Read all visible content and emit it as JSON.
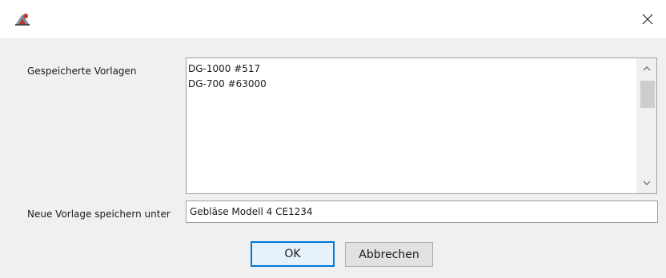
{
  "window": {
    "title": "",
    "app_icon": "app-logo-icon",
    "close_icon": "close-icon"
  },
  "form": {
    "saved_templates_label": "Gespeicherte Vorlagen",
    "saved_templates": [
      "DG-1000 #517",
      "DG-700 #63000"
    ],
    "new_template_label": "Neue Vorlage speichern unter",
    "new_template_value": "Gebläse Modell 4 CE1234"
  },
  "buttons": {
    "ok_label": "OK",
    "cancel_label": "Abbrechen"
  },
  "colors": {
    "dialog_background": "#f0f0f0",
    "ok_border": "#0078d7",
    "ok_background": "#e5f1fb",
    "cancel_background": "#e1e1e1"
  }
}
